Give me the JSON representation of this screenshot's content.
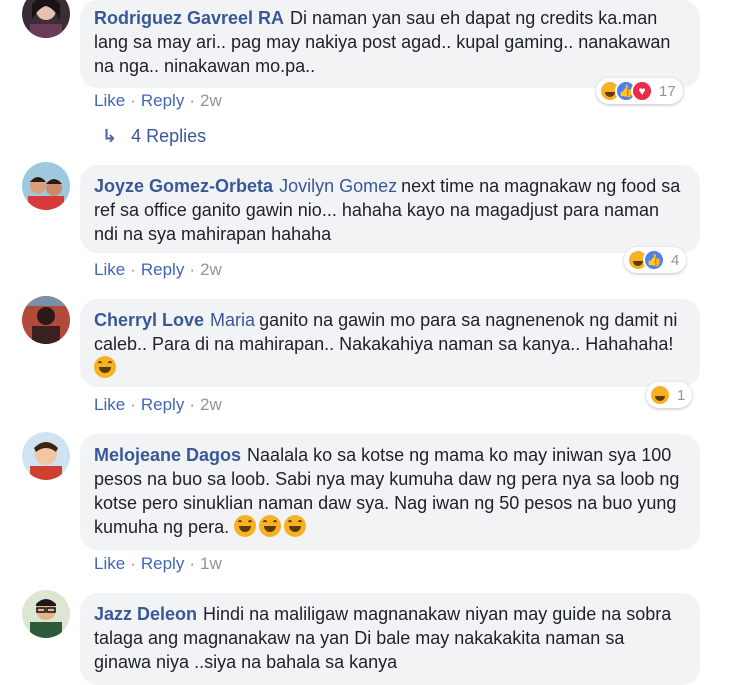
{
  "comments": [
    {
      "name": "Rodriguez Gavreel RA",
      "tag": "",
      "text": "Di naman yan sau eh dapat ng credits ka.man lang sa may ari.. pag may nakiya post agad.. kupal gaming.. nanakawan na nga.. ninakawan mo.pa..",
      "like": "Like",
      "reply": "Reply",
      "time": "2w",
      "reaction_count": "17",
      "reactions": [
        "haha-icon",
        "like-icon",
        "love-icon"
      ],
      "replies_label": "4 Replies"
    },
    {
      "name": "Joyze Gomez-Orbeta",
      "tag": "Jovilyn Gomez",
      "text": "next time na magnakaw ng food sa ref sa office ganito gawin nio... hahaha kayo na magadjust para naman ndi na sya mahirapan hahaha",
      "like": "Like",
      "reply": "Reply",
      "time": "2w",
      "reaction_count": "4",
      "reactions": [
        "haha-icon",
        "like-icon"
      ]
    },
    {
      "name": "Cherryl Love",
      "tag": "Maria",
      "text": "ganito na gawin mo para sa nagnenenok ng damit ni caleb.. Para di na mahirapan.. Nakakahiya naman sa kanya.. Hahahaha!",
      "emoji_count": 1,
      "like": "Like",
      "reply": "Reply",
      "time": "2w",
      "reaction_count": "1",
      "reactions": [
        "haha-icon"
      ]
    },
    {
      "name": "Melojeane Dagos",
      "tag": "",
      "text": "Naalala ko sa kotse ng mama ko may iniwan sya 100 pesos na buo sa loob. Sabi nya may kumuha daw ng pera nya sa loob ng kotse pero sinuklian naman daw sya. Nag iwan ng 50 pesos na buo yung kumuha ng pera.",
      "emoji_count": 3,
      "like": "Like",
      "reply": "Reply",
      "time": "1w"
    },
    {
      "name": "Jazz Deleon",
      "tag": "",
      "text": "Hindi na maliligaw magnanakaw niyan may guide na sobra talaga ang magnanakaw na yan Di bale may nakakakita naman sa ginawa niya ..siya na bahala sa kanya"
    }
  ],
  "colors": {
    "name": "#385898",
    "bubble": "#f2f3f5",
    "link": "#4267b2",
    "meta": "#90949c"
  }
}
